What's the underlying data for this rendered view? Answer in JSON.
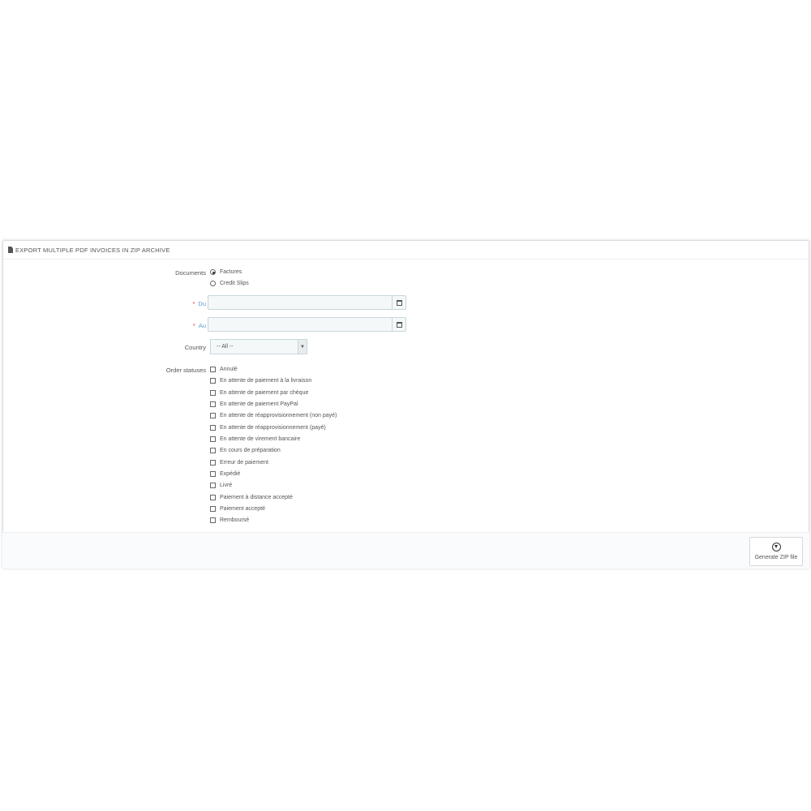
{
  "panel": {
    "title": "Export multiple PDF invoices in ZIP archive",
    "icon": "document-icon"
  },
  "documents": {
    "label": "Documents",
    "options": [
      {
        "label": "Factures",
        "selected": true
      },
      {
        "label": "Credit Slips",
        "selected": false
      }
    ]
  },
  "date_from": {
    "label": "Du",
    "required_mark": "*",
    "value": "",
    "icon": "calendar-icon"
  },
  "date_to": {
    "label": "Au",
    "required_mark": "*",
    "value": "",
    "icon": "calendar-icon"
  },
  "country": {
    "label": "Country",
    "selected": "-- All --",
    "icon": "chevron-down-icon"
  },
  "order_statuses": {
    "label": "Order statuses",
    "items": [
      {
        "label": "Annulé",
        "checked": false
      },
      {
        "label": "En attente de paiement à la livraison",
        "checked": false
      },
      {
        "label": "En attente de paiement par chèque",
        "checked": false
      },
      {
        "label": "En attente de paiement PayPal",
        "checked": false
      },
      {
        "label": "En attente de réapprovisionnement (non payé)",
        "checked": false
      },
      {
        "label": "En attente de réapprovisionnement (payé)",
        "checked": false
      },
      {
        "label": "En attente de virement bancaire",
        "checked": false
      },
      {
        "label": "En cours de préparation",
        "checked": false
      },
      {
        "label": "Erreur de paiement",
        "checked": false
      },
      {
        "label": "Expédié",
        "checked": false
      },
      {
        "label": "Livré",
        "checked": false
      },
      {
        "label": "Paiement à distance accepté",
        "checked": false
      },
      {
        "label": "Paiement accepté",
        "checked": false
      },
      {
        "label": "Remboursé",
        "checked": false
      }
    ]
  },
  "footer": {
    "generate_label": "Generate ZIP file",
    "icon": "download-icon"
  },
  "colors": {
    "required": "#e0383e",
    "label_accent": "#5b9bd1"
  }
}
